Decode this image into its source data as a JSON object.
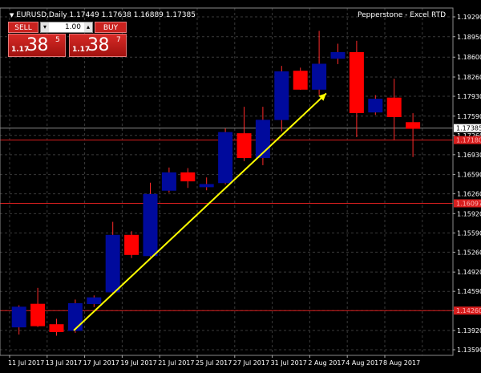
{
  "header": {
    "symbol_info": "EURUSD,Daily  1.17449 1.17638 1.16889 1.17385",
    "broker": "Pepperstone - Excel RTD"
  },
  "trade_panel": {
    "sell_label": "SELL",
    "buy_label": "BUY",
    "lot_size": "1.00",
    "sell_price_prefix": "1.17",
    "sell_price_main": "38",
    "sell_price_sup": "5",
    "buy_price_prefix": "1.17",
    "buy_price_main": "38",
    "buy_price_sup": "7",
    "icon_dropdown": "chevron-down-icon",
    "icon_stepper": "chevron-up-icon"
  },
  "colors": {
    "background": "#000000",
    "grid": "#3a3a3a",
    "bull_candle": "#000a9c",
    "bear_candle": "#ff0000",
    "wick": "#ff2a2a",
    "trendline": "#ffff00",
    "hline": "#d81e1e",
    "axis_text": "#ffffff"
  },
  "chart_data": {
    "type": "candlestick",
    "symbol": "EURUSD",
    "timeframe": "Daily",
    "ohlc_last": {
      "open": 1.17449,
      "high": 1.17638,
      "low": 1.16889,
      "close": 1.17385
    },
    "y_ticks": [
      "1.19290",
      "1.18950",
      "1.18600",
      "1.18260",
      "1.17930",
      "1.17590",
      "1.17260",
      "1.16930",
      "1.16590",
      "1.16260",
      "1.15920",
      "1.15590",
      "1.15260",
      "1.14920",
      "1.14590",
      "1.14260",
      "1.13920",
      "1.13590"
    ],
    "y_tick_values": [
      1.1929,
      1.1895,
      1.186,
      1.1826,
      1.1793,
      1.1759,
      1.1726,
      1.1693,
      1.1659,
      1.1626,
      1.1592,
      1.1559,
      1.1526,
      1.1492,
      1.1459,
      1.1426,
      1.1392,
      1.1359
    ],
    "x_tick_labels": [
      "11 Jul 2017",
      "13 Jul 2017",
      "17 Jul 2017",
      "19 Jul 2017",
      "21 Jul 2017",
      "25 Jul 2017",
      "27 Jul 2017",
      "31 Jul 2017",
      "2 Aug 2017",
      "4 Aug 2017",
      "8 Aug 2017"
    ],
    "price_labels": [
      {
        "text": "1.17385",
        "value": 1.17385,
        "style": "current"
      },
      {
        "text": "1.17180",
        "value": 1.1718,
        "style": "line"
      },
      {
        "text": "1.16097",
        "value": 1.16097,
        "style": "line"
      },
      {
        "text": "1.14260",
        "value": 1.1426,
        "style": "line"
      }
    ],
    "candles": [
      {
        "o": 1.1398,
        "h": 1.1435,
        "l": 1.1385,
        "c": 1.1432
      },
      {
        "o": 1.1437,
        "h": 1.1465,
        "l": 1.1398,
        "c": 1.14
      },
      {
        "o": 1.1402,
        "h": 1.1412,
        "l": 1.1383,
        "c": 1.139
      },
      {
        "o": 1.1392,
        "h": 1.1445,
        "l": 1.1388,
        "c": 1.1438
      },
      {
        "o": 1.1438,
        "h": 1.1452,
        "l": 1.1432,
        "c": 1.1448
      },
      {
        "o": 1.1458,
        "h": 1.1578,
        "l": 1.1455,
        "c": 1.1555
      },
      {
        "o": 1.1555,
        "h": 1.1562,
        "l": 1.1516,
        "c": 1.1522
      },
      {
        "o": 1.152,
        "h": 1.1645,
        "l": 1.1518,
        "c": 1.1625
      },
      {
        "o": 1.1632,
        "h": 1.1671,
        "l": 1.1628,
        "c": 1.1662
      },
      {
        "o": 1.1662,
        "h": 1.167,
        "l": 1.1636,
        "c": 1.1648
      },
      {
        "o": 1.1638,
        "h": 1.1654,
        "l": 1.1632,
        "c": 1.1642
      },
      {
        "o": 1.1645,
        "h": 1.1738,
        "l": 1.1642,
        "c": 1.1731
      },
      {
        "o": 1.1729,
        "h": 1.1775,
        "l": 1.1682,
        "c": 1.1688
      },
      {
        "o": 1.1688,
        "h": 1.1775,
        "l": 1.1675,
        "c": 1.1752
      },
      {
        "o": 1.1753,
        "h": 1.1845,
        "l": 1.1733,
        "c": 1.1835
      },
      {
        "o": 1.1836,
        "h": 1.1842,
        "l": 1.1804,
        "c": 1.1805
      },
      {
        "o": 1.1805,
        "h": 1.1905,
        "l": 1.1795,
        "c": 1.1848
      },
      {
        "o": 1.1858,
        "h": 1.1883,
        "l": 1.1848,
        "c": 1.1868
      },
      {
        "o": 1.1868,
        "h": 1.1888,
        "l": 1.1723,
        "c": 1.1765
      },
      {
        "o": 1.1766,
        "h": 1.1795,
        "l": 1.1761,
        "c": 1.1788
      },
      {
        "o": 1.179,
        "h": 1.1823,
        "l": 1.1718,
        "c": 1.1758
      },
      {
        "o": 1.1748,
        "h": 1.1764,
        "l": 1.1689,
        "c": 1.1738
      }
    ]
  }
}
